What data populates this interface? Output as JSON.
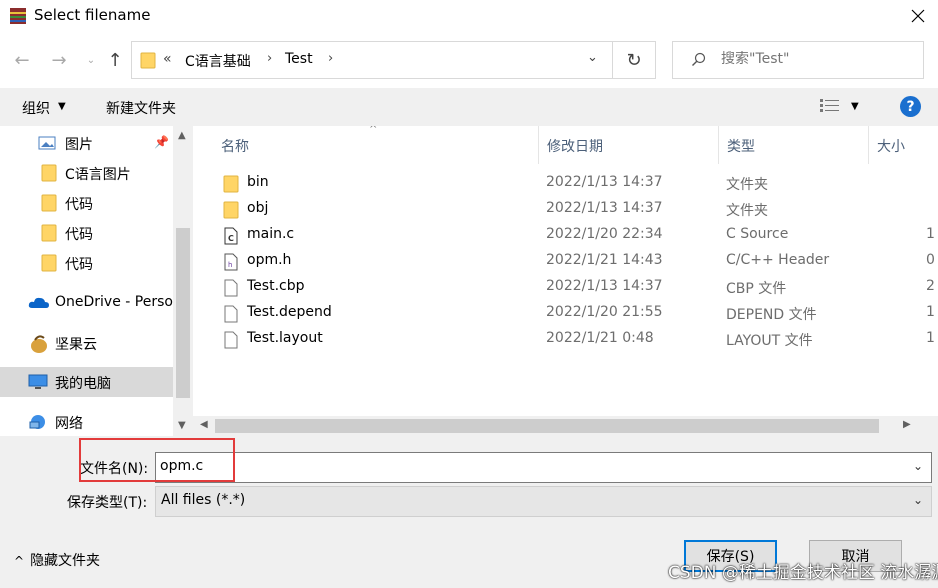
{
  "window": {
    "title": "Select filename"
  },
  "address": {
    "crumbs": [
      "C语言基础",
      "Test"
    ],
    "prefix": "«"
  },
  "search": {
    "placeholder": "搜索\"Test\""
  },
  "toolbar": {
    "organize_label": "组织",
    "new_folder_label": "新建文件夹"
  },
  "nav": {
    "items": [
      {
        "label": "图片",
        "icon": "pictures-icon"
      },
      {
        "label": "C语言图片",
        "icon": "folder-icon"
      },
      {
        "label": "代码",
        "icon": "folder-icon"
      },
      {
        "label": "代码",
        "icon": "folder-icon"
      },
      {
        "label": "代码",
        "icon": "folder-icon"
      },
      {
        "label": "OneDrive - Perso",
        "icon": "onedrive-icon"
      },
      {
        "label": "坚果云",
        "icon": "nutstore-icon"
      },
      {
        "label": "我的电脑",
        "icon": "computer-icon",
        "selected": true
      },
      {
        "label": "网络",
        "icon": "network-icon"
      }
    ]
  },
  "columns": {
    "name": "名称",
    "date": "修改日期",
    "type": "类型",
    "size": "大小"
  },
  "files": [
    {
      "name": "bin",
      "date": "2022/1/13 14:37",
      "type": "文件夹",
      "size": "",
      "icon": "folder-icon"
    },
    {
      "name": "obj",
      "date": "2022/1/13 14:37",
      "type": "文件夹",
      "size": "",
      "icon": "folder-icon"
    },
    {
      "name": "main.c",
      "date": "2022/1/20 22:34",
      "type": "C Source",
      "size": "1",
      "icon": "c-source-icon"
    },
    {
      "name": "opm.h",
      "date": "2022/1/21 14:43",
      "type": "C/C++ Header",
      "size": "0",
      "icon": "header-file-icon"
    },
    {
      "name": "Test.cbp",
      "date": "2022/1/13 14:37",
      "type": "CBP 文件",
      "size": "2",
      "icon": "file-icon"
    },
    {
      "name": "Test.depend",
      "date": "2022/1/20 21:55",
      "type": "DEPEND 文件",
      "size": "1",
      "icon": "file-icon"
    },
    {
      "name": "Test.layout",
      "date": "2022/1/21 0:48",
      "type": "LAYOUT 文件",
      "size": "1",
      "icon": "file-icon"
    }
  ],
  "filename": {
    "label": "文件名(N):",
    "value": "opm.c"
  },
  "filetype": {
    "label": "保存类型(T):",
    "value": "All files (*.*)"
  },
  "footer": {
    "hide_folders": "隐藏文件夹",
    "save": "保存(S)",
    "cancel": "取消"
  },
  "watermark": "CSDN @稀土掘金技术社区 流水潺潺",
  "colors": {
    "accent": "#0078d7",
    "highlight_box": "#e23b3b",
    "selected_bg": "#d9d9d9",
    "folder": "#ffd566"
  }
}
